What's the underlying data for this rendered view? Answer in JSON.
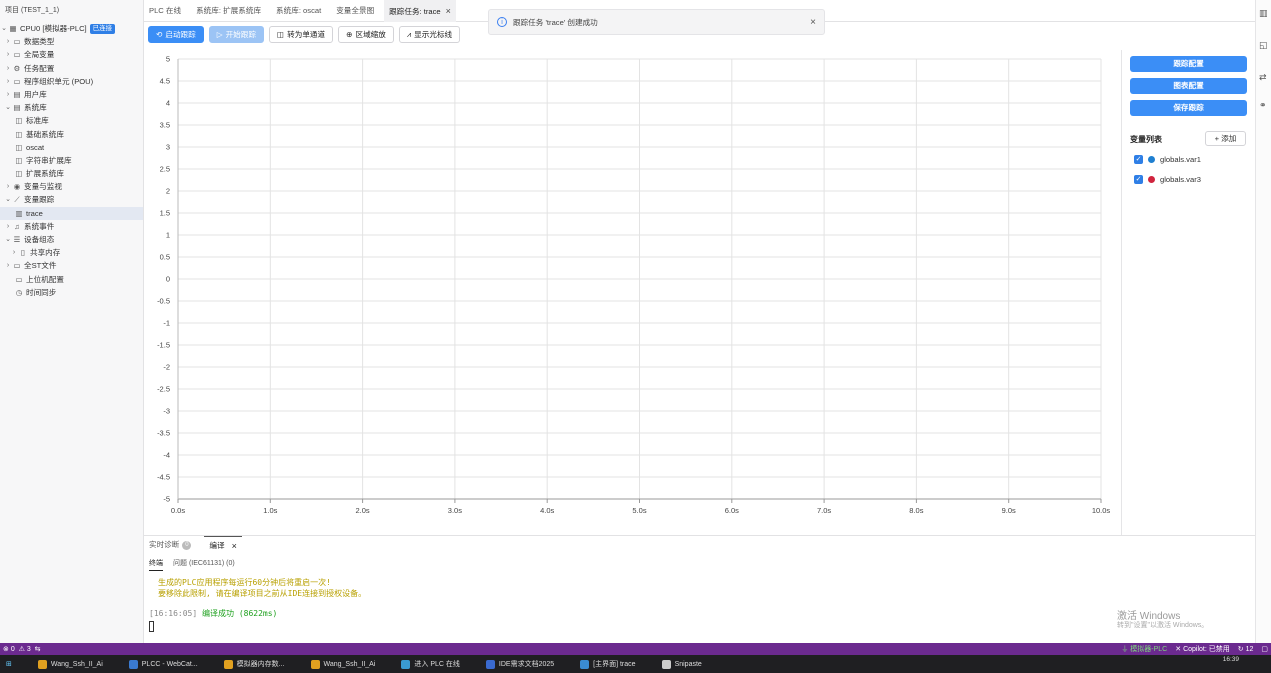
{
  "sidebar": {
    "header": "项目 (TEST_1_1)",
    "cpu_label": "CPU0 [模拟器-PLC]",
    "cpu_status": "已连接",
    "items": [
      {
        "label": "数据类型",
        "icon": "folder-icon"
      },
      {
        "label": "全局变量",
        "icon": "folder-icon"
      },
      {
        "label": "任务配置",
        "icon": "gear-icon"
      },
      {
        "label": "程序组织单元 (POU)",
        "icon": "folder-icon"
      },
      {
        "label": "用户库",
        "icon": "library-icon"
      },
      {
        "label": "系统库",
        "icon": "library-icon"
      },
      {
        "label": "标准库",
        "icon": "book-icon"
      },
      {
        "label": "基础系统库",
        "icon": "book-icon"
      },
      {
        "label": "oscat",
        "icon": "book-icon"
      },
      {
        "label": "字符串扩展库",
        "icon": "book-icon"
      },
      {
        "label": "扩展系统库",
        "icon": "book-icon"
      },
      {
        "label": "变量与监视",
        "icon": "eye-icon"
      },
      {
        "label": "变量跟踪",
        "icon": "chart-icon"
      },
      {
        "label": "trace",
        "icon": "bar-chart-icon"
      },
      {
        "label": "系统事件",
        "icon": "bell-icon"
      },
      {
        "label": "设备组态",
        "icon": "device-icon"
      },
      {
        "label": "共享内存",
        "icon": "memory-icon"
      },
      {
        "label": "全ST文件",
        "icon": "folder-icon"
      },
      {
        "label": "上位机配置",
        "icon": "monitor-icon"
      },
      {
        "label": "时间同步",
        "icon": "clock-icon"
      }
    ]
  },
  "tabs": [
    {
      "label": "PLC 在线"
    },
    {
      "label": "系统库: 扩展系统库"
    },
    {
      "label": "系统库: oscat"
    },
    {
      "label": "变量全景图"
    },
    {
      "label": "跟踪任务: trace"
    }
  ],
  "toast": {
    "message": "跟踪任务 'trace' 创建成功"
  },
  "toolbar": {
    "start_trace": "启动跟踪",
    "begin_trace": "开始跟踪",
    "single_channel": "转为单通道",
    "zoom_area": "区域缩放",
    "show_cursor": "显示光标线"
  },
  "right_panel": {
    "trace_config": "跟踪配置",
    "chart_config": "图表配置",
    "save_trace": "保存跟踪",
    "var_list_title": "变量列表",
    "add_button": "+ 添加",
    "variables": [
      {
        "name": "globals.var1",
        "color": "#1f7fd0",
        "checked": true
      },
      {
        "name": "globals.var3",
        "color": "#d0243e",
        "checked": true
      }
    ]
  },
  "chart_data": {
    "type": "line",
    "title": "",
    "xlabel": "",
    "ylabel": "",
    "xlim": [
      0,
      10
    ],
    "ylim": [
      -5,
      5
    ],
    "x_ticks": [
      "0.0s",
      "1.0s",
      "2.0s",
      "3.0s",
      "4.0s",
      "5.0s",
      "6.0s",
      "7.0s",
      "8.0s",
      "9.0s",
      "10.0s"
    ],
    "y_ticks": [
      "5",
      "4.5",
      "4",
      "3.5",
      "3",
      "2.5",
      "2",
      "1.5",
      "1",
      "0.5",
      "0",
      "-0.5",
      "-1",
      "-1.5",
      "-2",
      "-2.5",
      "-3",
      "-3.5",
      "-4",
      "-4.5",
      "-5"
    ],
    "grid": true,
    "series": []
  },
  "bottom": {
    "tab_diag": "实时诊断",
    "tab_diag_count": "0",
    "tab_compile": "编译",
    "sub_terminal": "终端",
    "sub_problems": "问题 (IEC61131) (0)",
    "line1": "生成的PLC应用程序每运行60分钟后将重启一次!",
    "line2": "要移除此限制, 请在编译项目之前从IDE连接到授权设备。",
    "line3_time": "[16:16:05]",
    "line3_msg": "编译成功 (8622ms)",
    "watermark1": "激活 Windows",
    "watermark2": "转到\"设置\"以激活 Windows。"
  },
  "status": {
    "errors": "0",
    "warnings": "3",
    "sim": "模拟器-PLC",
    "copilot": "Copilot: 已禁用",
    "count": "12"
  },
  "taskbar": {
    "time": "16:39",
    "items": [
      {
        "label": "Wang_Ssh_II_Ai",
        "color": "#e0a020"
      },
      {
        "label": "PLCC - WebCat...",
        "color": "#3a7ad0"
      },
      {
        "label": "模拟器内存数...",
        "color": "#e0a020"
      },
      {
        "label": "Wang_Ssh_II_Ai",
        "color": "#e0a020"
      },
      {
        "label": "进入 PLC 在线",
        "color": "#3a9ad0"
      },
      {
        "label": "IDE需求文档2025",
        "color": "#3a6ad0"
      },
      {
        "label": "[主界面] trace",
        "color": "#3a8ad0"
      },
      {
        "label": "Snipaste",
        "color": "#cccccc"
      }
    ]
  }
}
